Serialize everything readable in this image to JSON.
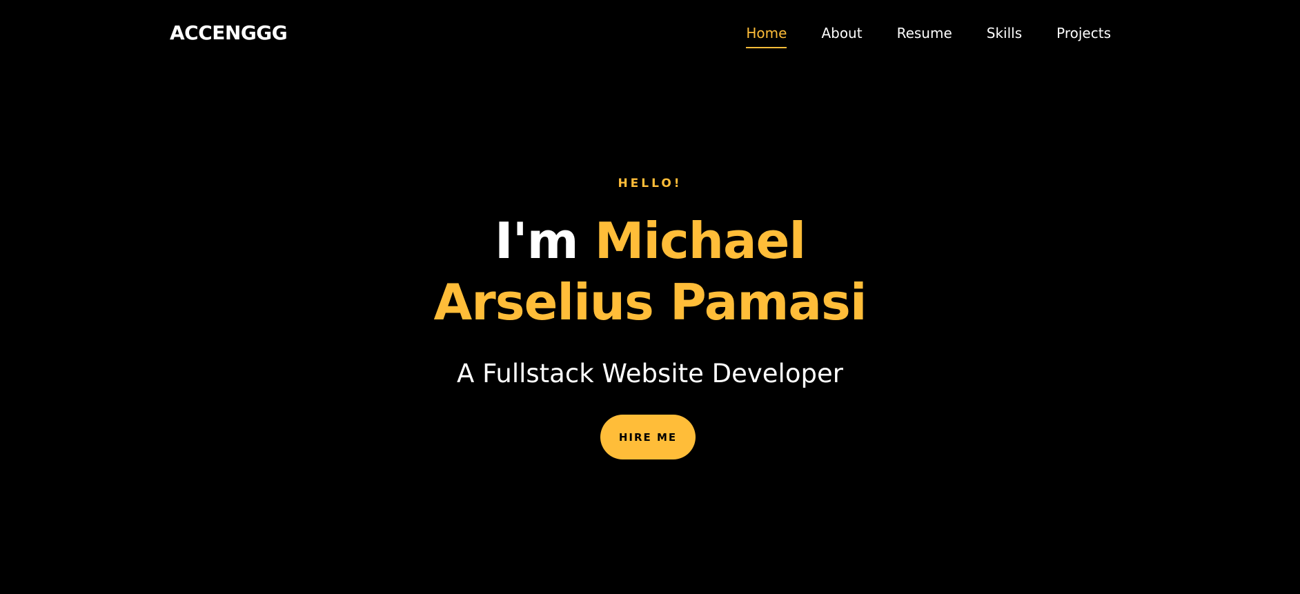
{
  "navbar": {
    "brand": "ACCENGGG",
    "links": [
      {
        "label": "Home",
        "active": true
      },
      {
        "label": "About",
        "active": false
      },
      {
        "label": "Resume",
        "active": false
      },
      {
        "label": "Skills",
        "active": false
      },
      {
        "label": "Projects",
        "active": false
      }
    ]
  },
  "hero": {
    "greeting": "HELLO!",
    "headline_prefix": "I'm ",
    "headline_name_line1": "Michael",
    "headline_name_line2": "Arselius Pamasi",
    "subtitle": "A Fullstack Website Developer",
    "cta_label": "HIRE ME"
  },
  "colors": {
    "background": "#000000",
    "accent": "#ffbd39",
    "text": "#ffffff"
  }
}
